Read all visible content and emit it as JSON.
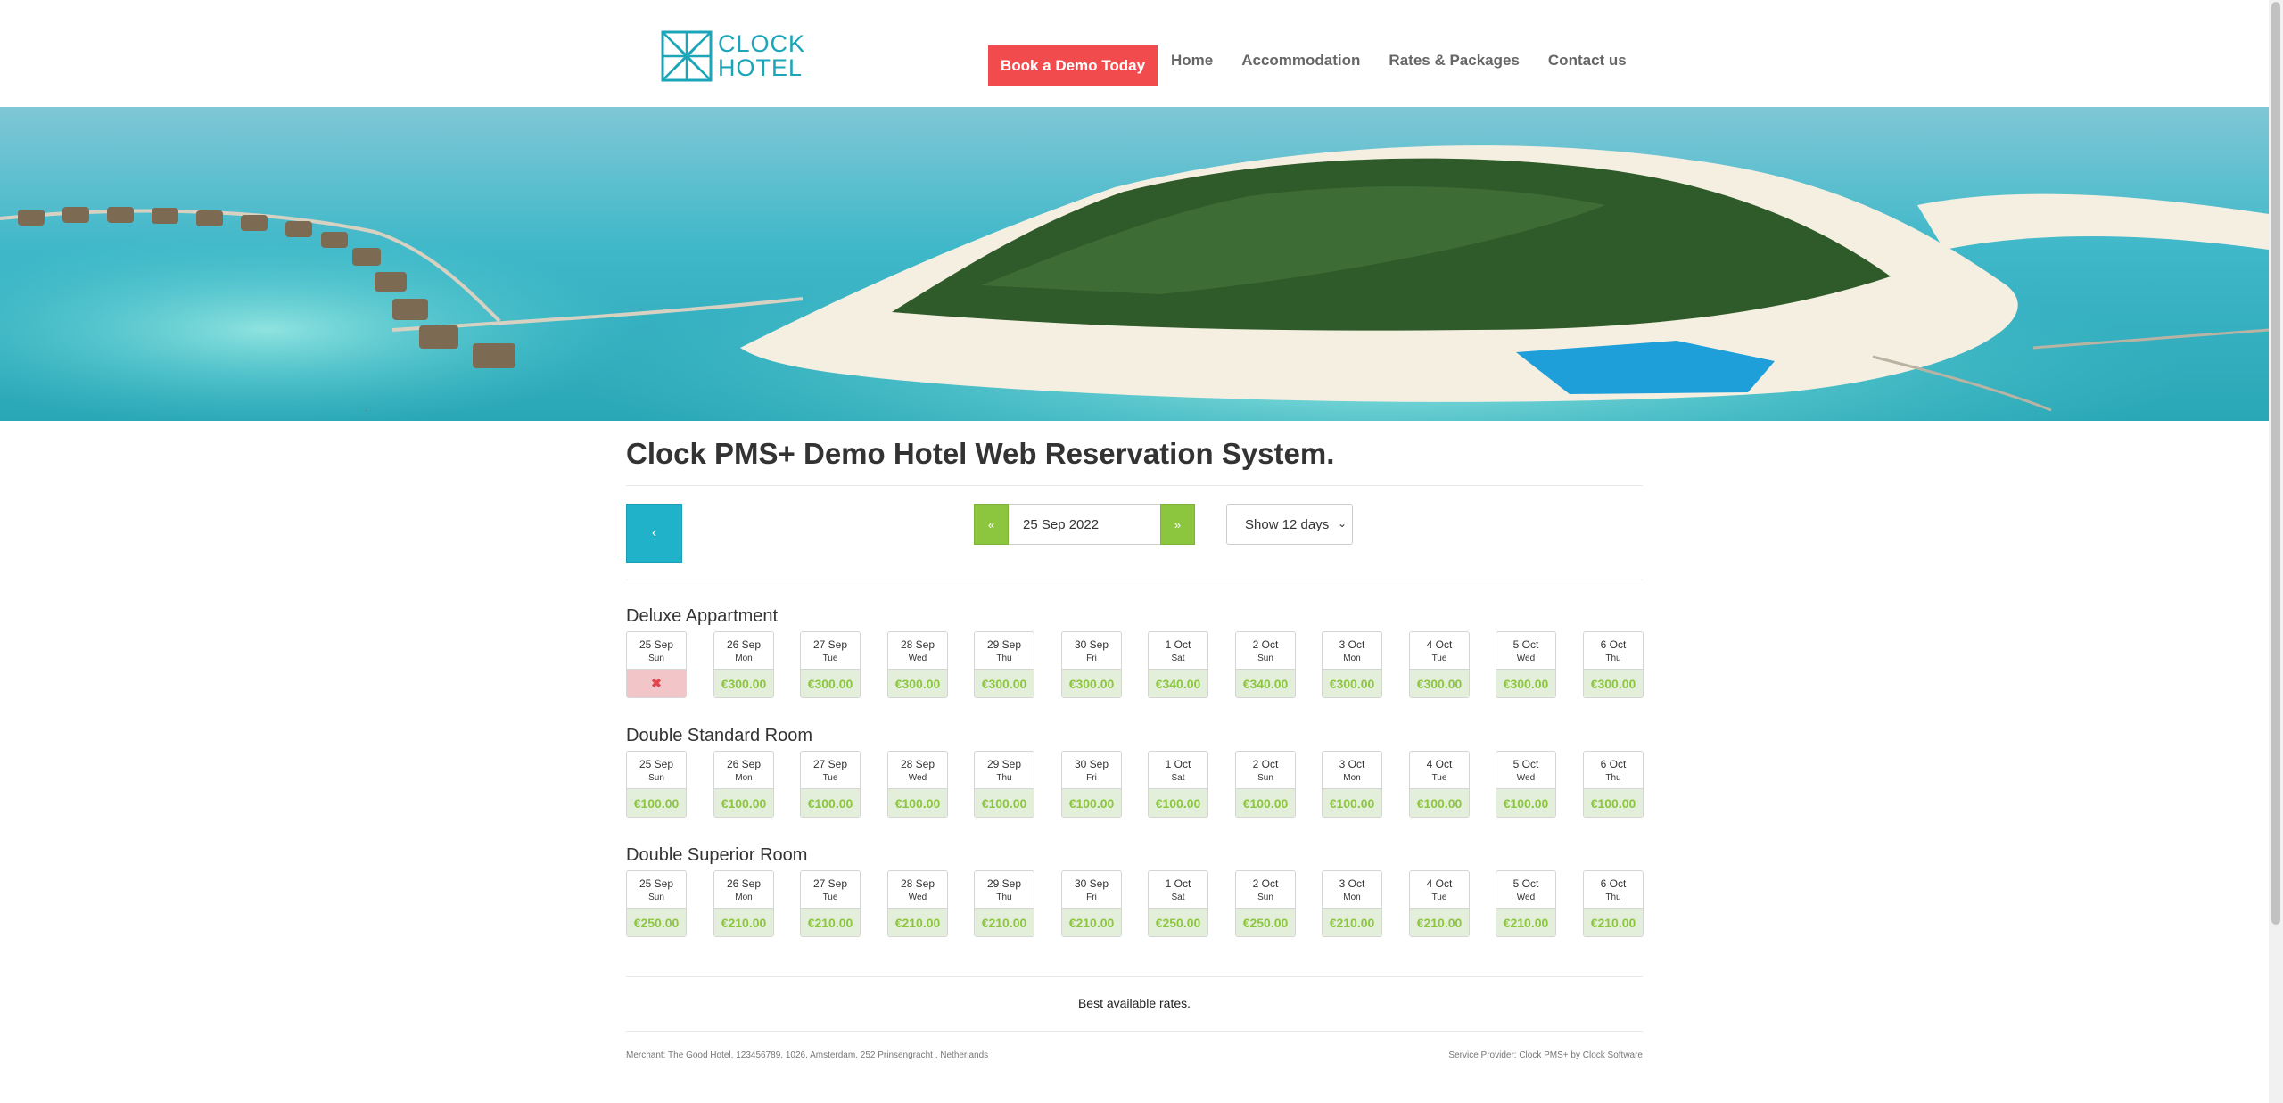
{
  "header": {
    "logo_line1": "CLOCK",
    "logo_line2": "HOTEL",
    "demo_button": "Book a Demo Today",
    "nav": [
      "Home",
      "Accommodation",
      "Rates & Packages",
      "Contact us"
    ]
  },
  "page": {
    "title": "Clock PMS+ Demo Hotel Web Reservation System.",
    "prev_button": "‹",
    "date_prev": "«",
    "date_next": "»",
    "date_value": "25 Sep 2022",
    "days_select": "Show 12 days",
    "best_rates": "Best available rates.",
    "footer_left": "Merchant: The Good Hotel, 123456789, 1026, Amsterdam, 252 Prinsengracht , Netherlands",
    "footer_right": "Service Provider: Clock PMS+ by Clock Software"
  },
  "colors": {
    "accent_red": "#f24b4e",
    "accent_teal": "#1fb2c8",
    "accent_green": "#8cc63f"
  },
  "days": [
    {
      "date": "25 Sep",
      "dow": "Sun"
    },
    {
      "date": "26 Sep",
      "dow": "Mon"
    },
    {
      "date": "27 Sep",
      "dow": "Tue"
    },
    {
      "date": "28 Sep",
      "dow": "Wed"
    },
    {
      "date": "29 Sep",
      "dow": "Thu"
    },
    {
      "date": "30 Sep",
      "dow": "Fri"
    },
    {
      "date": "1 Oct",
      "dow": "Sat"
    },
    {
      "date": "2 Oct",
      "dow": "Sun"
    },
    {
      "date": "3 Oct",
      "dow": "Mon"
    },
    {
      "date": "4 Oct",
      "dow": "Tue"
    },
    {
      "date": "5 Oct",
      "dow": "Wed"
    },
    {
      "date": "6 Oct",
      "dow": "Thu"
    }
  ],
  "rooms": [
    {
      "name": "Deluxe Appartment",
      "prices": [
        "✖",
        "€300.00",
        "€300.00",
        "€300.00",
        "€300.00",
        "€300.00",
        "€340.00",
        "€340.00",
        "€300.00",
        "€300.00",
        "€300.00",
        "€300.00"
      ]
    },
    {
      "name": "Double Standard Room",
      "prices": [
        "€100.00",
        "€100.00",
        "€100.00",
        "€100.00",
        "€100.00",
        "€100.00",
        "€100.00",
        "€100.00",
        "€100.00",
        "€100.00",
        "€100.00",
        "€100.00"
      ]
    },
    {
      "name": "Double Superior Room",
      "prices": [
        "€250.00",
        "€210.00",
        "€210.00",
        "€210.00",
        "€210.00",
        "€210.00",
        "€250.00",
        "€250.00",
        "€210.00",
        "€210.00",
        "€210.00",
        "€210.00"
      ]
    }
  ]
}
